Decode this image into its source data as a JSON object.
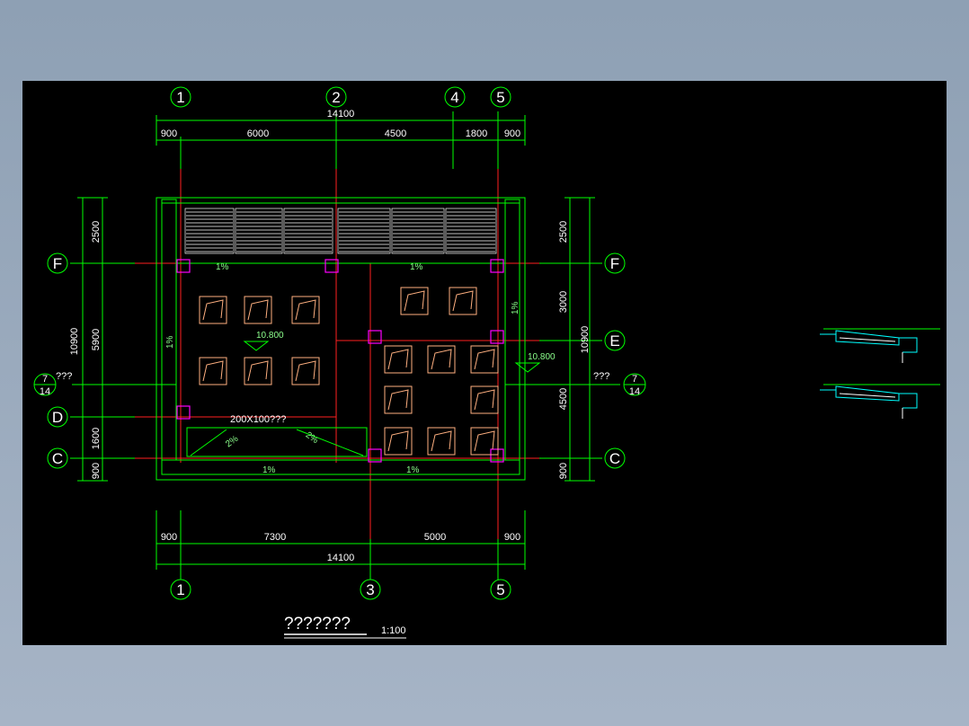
{
  "dims_top": {
    "total": "14100",
    "segments": [
      "900",
      "6000",
      "4500",
      "1800",
      "900"
    ]
  },
  "dims_bottom": {
    "total": "14100",
    "segments": [
      "900",
      "7300",
      "5000",
      "900"
    ]
  },
  "dims_left": {
    "total": "10900",
    "segments": [
      "2500",
      "5900",
      "1600",
      "900"
    ]
  },
  "dims_right": {
    "total": "10900",
    "segments": [
      "2500",
      "3000",
      "4500",
      "900"
    ]
  },
  "axes_top": [
    "1",
    "2",
    "4",
    "5"
  ],
  "axes_bottom": [
    "1",
    "3",
    "5"
  ],
  "axes_left": [
    "F",
    "D",
    "C"
  ],
  "axes_right": [
    "F",
    "E",
    "C"
  ],
  "detail_ref": {
    "num": "7",
    "sheet": "14",
    "label": "???"
  },
  "elevation_left": "10.800",
  "elevation_right": "10.800",
  "gutter_label": "200X100???",
  "slopes": {
    "s1": "1%",
    "s2": "1%",
    "s3": "1%",
    "s4": "1%",
    "s5": "1%",
    "s6": "1%",
    "s7": "2%",
    "s8": "2%"
  },
  "title": "???????",
  "scale": "1:100",
  "colors": {
    "bg": "#000000",
    "green": "#00ff00",
    "red": "#ff2020",
    "magenta": "#ff00ff",
    "orange": "#ffb080",
    "white": "#ffffff"
  }
}
